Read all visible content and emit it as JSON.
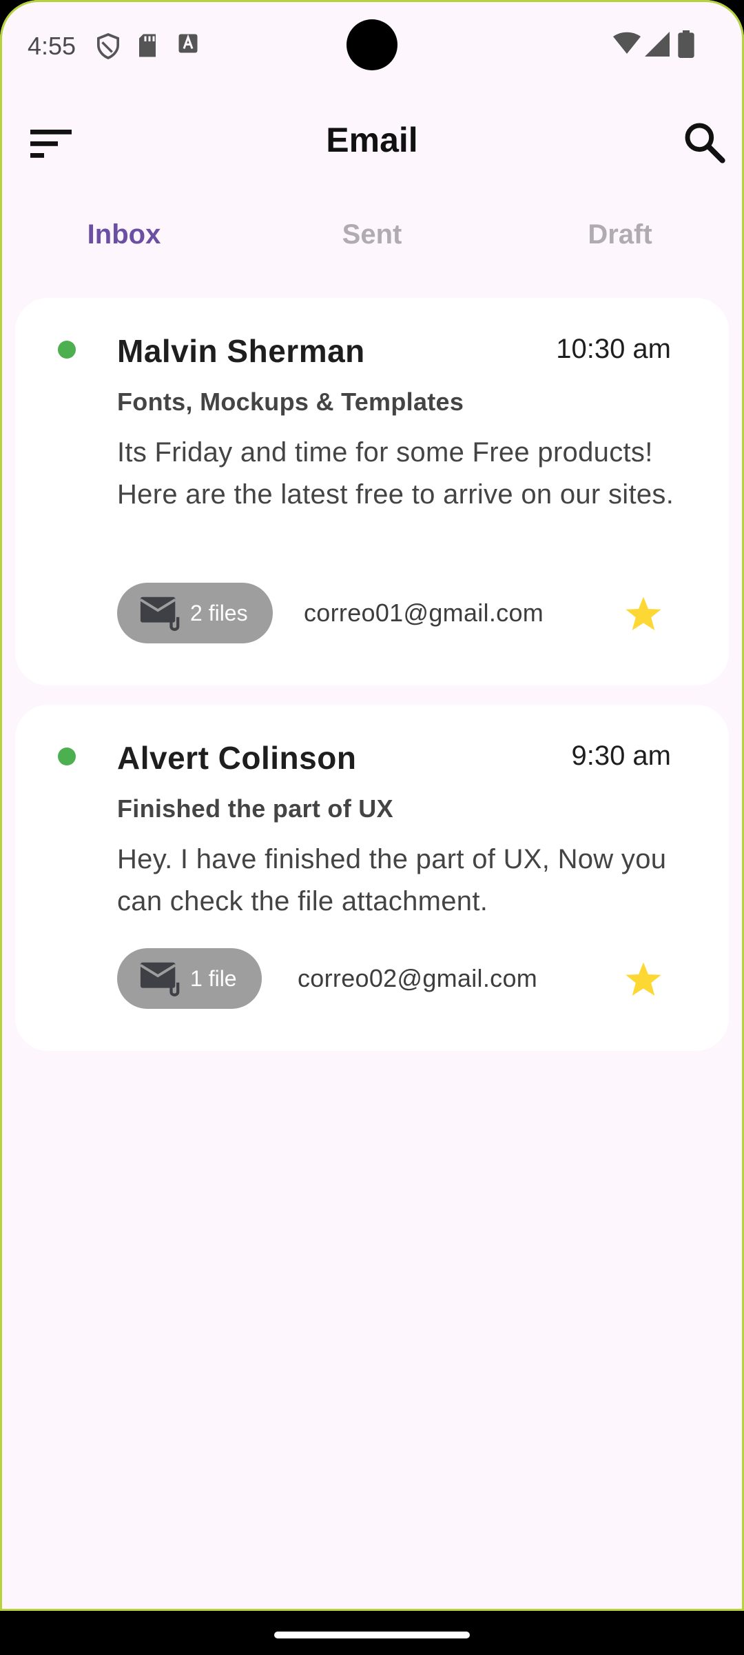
{
  "status_bar": {
    "time": "4:55"
  },
  "app_bar": {
    "title": "Email",
    "menu_icon": "sort-menu-icon",
    "search_icon": "search-icon"
  },
  "tabs": [
    {
      "label": "Inbox",
      "active": true
    },
    {
      "label": "Sent",
      "active": false
    },
    {
      "label": "Draft",
      "active": false
    }
  ],
  "emails": [
    {
      "sender": "Malvin Sherman",
      "time": "10:30 am",
      "subject": "Fonts, Mockups & Templates",
      "preview": "Its Friday and time for some Free products! Here are the latest free to arrive on our sites.",
      "attachments": "2 files",
      "email": "correo01@gmail.com",
      "starred": true
    },
    {
      "sender": "Alvert Colinson",
      "time": "9:30 am",
      "subject": "Finished the part of UX",
      "preview": "Hey. I have finished the part of UX, Now you can check the file attachment.",
      "attachments": "1 file",
      "email": "correo02@gmail.com",
      "starred": true
    }
  ],
  "colors": {
    "background": "#fdf6fc",
    "accent": "#6b4fa3",
    "unread_dot": "#4caf50",
    "star": "#fdd835",
    "chip": "#9e9e9e"
  }
}
